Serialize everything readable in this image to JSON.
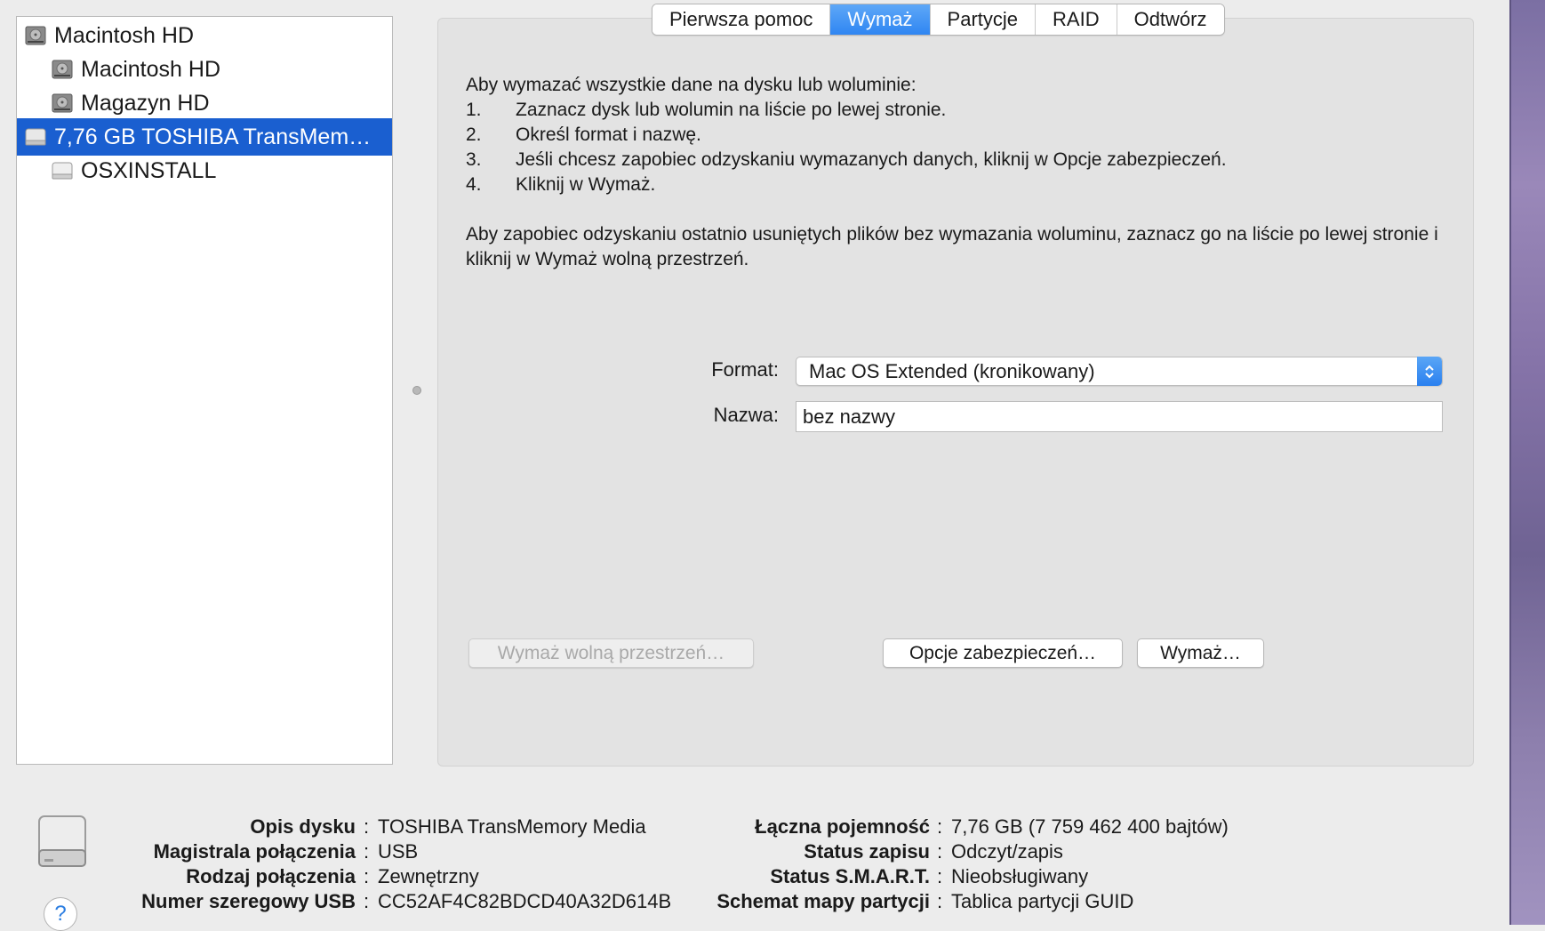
{
  "sidebar": {
    "items": [
      {
        "label": "Macintosh HD",
        "icon": "internal-disk-icon",
        "level": 0,
        "selected": false
      },
      {
        "label": "Macintosh HD",
        "icon": "volume-icon",
        "level": 1,
        "selected": false
      },
      {
        "label": "Magazyn HD",
        "icon": "volume-icon",
        "level": 1,
        "selected": false
      },
      {
        "label": "7,76 GB TOSHIBA TransMem…",
        "icon": "external-disk-icon",
        "level": 0,
        "selected": true
      },
      {
        "label": "OSXINSTALL",
        "icon": "external-volume-icon",
        "level": 1,
        "selected": false
      }
    ]
  },
  "tabs": [
    {
      "label": "Pierwsza pomoc",
      "active": false
    },
    {
      "label": "Wymaż",
      "active": true
    },
    {
      "label": "Partycje",
      "active": false
    },
    {
      "label": "RAID",
      "active": false
    },
    {
      "label": "Odtwórz",
      "active": false
    }
  ],
  "erase": {
    "intro": "Aby wymazać wszystkie dane na dysku lub woluminie:",
    "steps": [
      {
        "num": "1.",
        "text": "Zaznacz dysk lub wolumin na liście po lewej stronie."
      },
      {
        "num": "2.",
        "text": "Określ format i nazwę."
      },
      {
        "num": "3.",
        "text": "Jeśli chcesz zapobiec odzyskaniu wymazanych danych, kliknij w Opcje zabezpieczeń."
      },
      {
        "num": "4.",
        "text": "Kliknij w Wymaż."
      }
    ],
    "free_space_note": "Aby zapobiec odzyskaniu ostatnio usuniętych plików bez wymazania woluminu, zaznacz go na liście po lewej stronie i kliknij w Wymaż wolną przestrzeń.",
    "format_label": "Format:",
    "format_value": "Mac OS Extended (kronikowany)",
    "name_label": "Nazwa:",
    "name_value": "bez nazwy",
    "erase_free_space_button": "Wymaż wolną przestrzeń…",
    "security_options_button": "Opcje zabezpieczeń…",
    "erase_button": "Wymaż…"
  },
  "info": {
    "left": [
      {
        "key": "Opis dysku",
        "value": "TOSHIBA TransMemory Media"
      },
      {
        "key": "Magistrala połączenia",
        "value": "USB"
      },
      {
        "key": "Rodzaj połączenia",
        "value": "Zewnętrzny"
      },
      {
        "key": "Numer szeregowy USB",
        "value": "CC52AF4C82BDCD40A32D614B"
      }
    ],
    "right": [
      {
        "key": "Łączna pojemność",
        "value": "7,76 GB (7 759 462 400 bajtów)"
      },
      {
        "key": "Status zapisu",
        "value": "Odczyt/zapis"
      },
      {
        "key": "Status S.M.A.R.T.",
        "value": "Nieobsługiwany"
      },
      {
        "key": "Schemat mapy partycji",
        "value": "Tablica partycji GUID"
      }
    ],
    "separator": ":"
  },
  "help_label": "?",
  "colors": {
    "selection": "#1a5fd0",
    "accent": "#2f86f2"
  }
}
